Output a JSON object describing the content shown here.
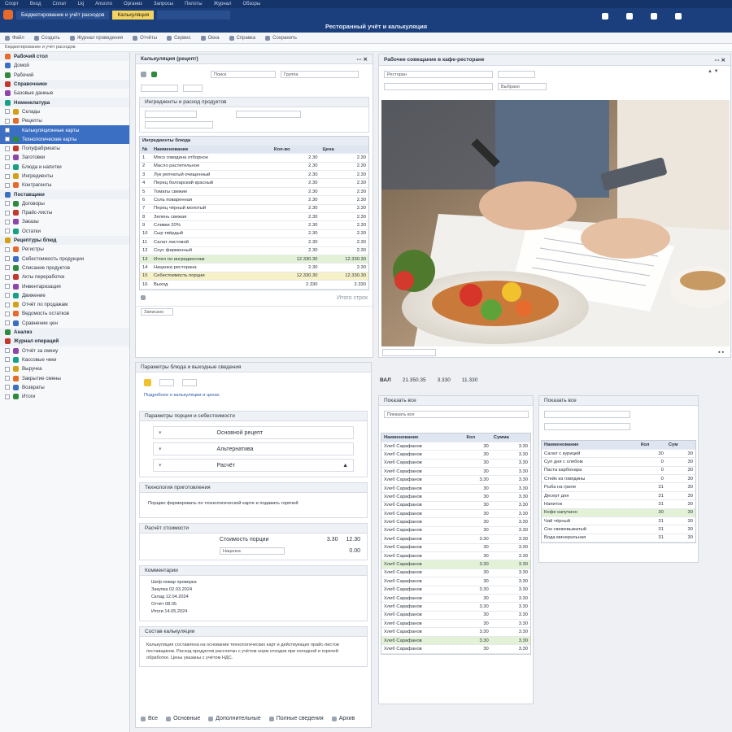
{
  "menu": [
    "Спорт",
    "Вход",
    "Сплат",
    "Lkj",
    "Аполло",
    "Организ",
    "Запросы",
    "Пилоты",
    "Журнал",
    "Обзоры"
  ],
  "app": {
    "title": "Бюджетирование и учёт расходов",
    "center_title": "Ресторанный учёт и калькуляция",
    "tab_active": "Калькуляция"
  },
  "toolbar": [
    "Файл",
    "Создать",
    "Журнал проведения",
    "Отчёты",
    "Сервис",
    "Окна",
    "Справка",
    "Сохранить"
  ],
  "sidebar": {
    "items": [
      {
        "label": "Рабочий стол",
        "type": "sec"
      },
      {
        "label": "Домой",
        "type": "item"
      },
      {
        "label": "Рабочий",
        "type": "item"
      },
      {
        "label": "Справочники",
        "type": "sec"
      },
      {
        "label": "Базовые данные",
        "type": "item"
      },
      {
        "label": "Номенклатура",
        "type": "sec"
      },
      {
        "label": "Склады",
        "type": "check"
      },
      {
        "label": "Рецепты",
        "type": "check"
      },
      {
        "label": "Калькуляционные карты",
        "type": "sel"
      },
      {
        "label": "Технологические карты",
        "type": "sel"
      },
      {
        "label": "Полуфабрикаты",
        "type": "check"
      },
      {
        "label": "Заготовки",
        "type": "check"
      },
      {
        "label": "Блюда и напитки",
        "type": "check"
      },
      {
        "label": "Ингредиенты",
        "type": "check"
      },
      {
        "label": "Контрагенты",
        "type": "check"
      },
      {
        "label": "Поставщики",
        "type": "sec"
      },
      {
        "label": "Договоры",
        "type": "check"
      },
      {
        "label": "Прайс-листы",
        "type": "check"
      },
      {
        "label": "Заказы",
        "type": "check"
      },
      {
        "label": "Остатки",
        "type": "check"
      },
      {
        "label": "Рецептуры блюд",
        "type": "sec"
      },
      {
        "label": "Регистры",
        "type": "check"
      },
      {
        "label": "Себестоимость продукции",
        "type": "check"
      },
      {
        "label": "Списание продуктов",
        "type": "check"
      },
      {
        "label": "Акты переработки",
        "type": "check"
      },
      {
        "label": "Инвентаризация",
        "type": "check"
      },
      {
        "label": "Движение",
        "type": "check"
      },
      {
        "label": "Отчёт по продажам",
        "type": "check"
      },
      {
        "label": "Ведомость остатков",
        "type": "check"
      },
      {
        "label": "Сравнение цен",
        "type": "check"
      },
      {
        "label": "Анализ",
        "type": "sec"
      },
      {
        "label": "Журнал операций",
        "type": "sec"
      },
      {
        "label": "Отчёт за смену",
        "type": "check"
      },
      {
        "label": "Кассовые чеки",
        "type": "check"
      },
      {
        "label": "Выручка",
        "type": "check"
      },
      {
        "label": "Закрытие смены",
        "type": "check"
      },
      {
        "label": "Возвраты",
        "type": "check"
      },
      {
        "label": "Итоги",
        "type": "check"
      }
    ]
  },
  "calc_panel": {
    "title": "Калькуляция (рецепт)",
    "sub": "Ингредиенты и расход продуктов",
    "search": "Поиск",
    "group": "Группа",
    "table_title": "Ингредиенты блюда",
    "columns": [
      "№",
      "Наименование",
      "Кол-во",
      "Цена"
    ],
    "rows": [
      {
        "n": "1",
        "name": "Мясо говядина отборное",
        "q": "2.30",
        "p": "2.30",
        "cls": ""
      },
      {
        "n": "2",
        "name": "Масло растительное",
        "q": "2.30",
        "p": "2.30",
        "cls": ""
      },
      {
        "n": "3",
        "name": "Лук репчатый очищенный",
        "q": "2.30",
        "p": "2.30",
        "cls": ""
      },
      {
        "n": "4",
        "name": "Перец болгарский красный",
        "q": "2.30",
        "p": "2.30",
        "cls": ""
      },
      {
        "n": "5",
        "name": "Томаты свежие",
        "q": "2.30",
        "p": "2.30",
        "cls": ""
      },
      {
        "n": "6",
        "name": "Соль поваренная",
        "q": "2.30",
        "p": "2.30",
        "cls": ""
      },
      {
        "n": "7",
        "name": "Перец чёрный молотый",
        "q": "2.30",
        "p": "2.30",
        "cls": ""
      },
      {
        "n": "8",
        "name": "Зелень свежая",
        "q": "2.30",
        "p": "2.30",
        "cls": ""
      },
      {
        "n": "9",
        "name": "Сливки 20%",
        "q": "2.30",
        "p": "2.30",
        "cls": ""
      },
      {
        "n": "10",
        "name": "Сыр твёрдый",
        "q": "2.30",
        "p": "2.30",
        "cls": ""
      },
      {
        "n": "11",
        "name": "Салат листовой",
        "q": "2.30",
        "p": "2.30",
        "cls": ""
      },
      {
        "n": "12",
        "name": "Соус фирменный",
        "q": "2.30",
        "p": "2.30",
        "cls": ""
      },
      {
        "n": "13",
        "name": "Итого по ингредиентам",
        "q": "12.330.30",
        "p": "12.330.30",
        "cls": "hl"
      },
      {
        "n": "14",
        "name": "Наценка ресторана",
        "q": "2.30",
        "p": "2.30",
        "cls": ""
      },
      {
        "n": "15",
        "name": "Себестоимость порции",
        "q": "12.330.30",
        "p": "12.330.30",
        "cls": "hy"
      },
      {
        "n": "16",
        "name": "Выход",
        "q": "2.330",
        "p": "2.330",
        "cls": ""
      }
    ],
    "footer": "Итого строк",
    "status": "Записано"
  },
  "photo_panel": {
    "title": "Рабочее совещание в кафе-ресторане",
    "field1": "Ресторан",
    "field2": "Выбрано"
  },
  "detail_panel": {
    "header": "Параметры блюда и выходные сведения",
    "link": "Подробнее о калькуляции и ценах",
    "sec1": "Параметры порции и себестоимости",
    "opt1": "Основной рецепт",
    "opt2": "Альтернатива",
    "opt3": "Расчёт",
    "sec2": "Технология приготовления",
    "text2": "Порцию формировать по технологической карте и подавать горячей",
    "sec3": "Расчёт стоимости",
    "calc_label": "Стоимость порции",
    "calc_a": "3.30",
    "calc_b": "12.30",
    "calc_label2": "Наценка",
    "calc_c": "0.00",
    "sec4": "Комментарии",
    "notes": [
      "Шеф-повар проверка",
      "Закупка 02.03.2024",
      "Склад 12.04.2024",
      "Отчёт 08.05",
      "Итоги 14.05.2024"
    ],
    "sec5": "Состав калькуляции",
    "para": "Калькуляция составлена на основании технологических карт и действующих прайс-листов поставщиков. Расход продуктов рассчитан с учётом норм отходов при холодной и горячей обработке. Цены указаны с учётом НДС.",
    "tabs": [
      "Все",
      "Основные",
      "Дополнительные",
      "Полные сведения",
      "Архив"
    ]
  },
  "stats": {
    "label": "ВАЛ",
    "v1": "21.350.35",
    "v2": "3.330",
    "v3": "11.330"
  },
  "right_table": {
    "filter": "Показать все",
    "columns": [
      "Наименование",
      "Кол",
      "Сумма"
    ],
    "rows": [
      {
        "name": "Хлеб Сарафанов",
        "q": "30",
        "p": "3.30",
        "cls": ""
      },
      {
        "name": "Хлеб Сарафанов",
        "q": "30",
        "p": "3.30",
        "cls": ""
      },
      {
        "name": "Хлеб Сарафанов",
        "q": "30",
        "p": "3.30",
        "cls": ""
      },
      {
        "name": "Хлеб Сарафанов",
        "q": "30",
        "p": "3.30",
        "cls": ""
      },
      {
        "name": "Хлеб Сарафанов",
        "q": "3.30",
        "p": "3.30",
        "cls": ""
      },
      {
        "name": "Хлеб Сарафанов",
        "q": "30",
        "p": "3.30",
        "cls": ""
      },
      {
        "name": "Хлеб Сарафанов",
        "q": "30",
        "p": "3.30",
        "cls": ""
      },
      {
        "name": "Хлеб Сарафанов",
        "q": "30",
        "p": "3.30",
        "cls": ""
      },
      {
        "name": "Хлеб Сарафанов",
        "q": "30",
        "p": "3.30",
        "cls": ""
      },
      {
        "name": "Хлеб Сарафанов",
        "q": "30",
        "p": "3.30",
        "cls": ""
      },
      {
        "name": "Хлеб Сарафанов",
        "q": "30",
        "p": "3.30",
        "cls": ""
      },
      {
        "name": "Хлеб Сарафанов",
        "q": "3.30",
        "p": "3.30",
        "cls": ""
      },
      {
        "name": "Хлеб Сарафанов",
        "q": "30",
        "p": "3.30",
        "cls": ""
      },
      {
        "name": "Хлеб Сарафанов",
        "q": "30",
        "p": "3.30",
        "cls": ""
      },
      {
        "name": "Хлеб Сарафанов",
        "q": "3.30",
        "p": "3.30",
        "cls": "hl"
      },
      {
        "name": "Хлеб Сарафанов",
        "q": "30",
        "p": "3.30",
        "cls": ""
      },
      {
        "name": "Хлеб Сарафанов",
        "q": "30",
        "p": "3.30",
        "cls": ""
      },
      {
        "name": "Хлеб Сарафанов",
        "q": "3.30",
        "p": "3.30",
        "cls": ""
      },
      {
        "name": "Хлеб Сарафанов",
        "q": "30",
        "p": "3.30",
        "cls": ""
      },
      {
        "name": "Хлеб Сарафанов",
        "q": "3.30",
        "p": "3.30",
        "cls": ""
      },
      {
        "name": "Хлеб Сарафанов",
        "q": "30",
        "p": "3.30",
        "cls": ""
      },
      {
        "name": "Хлеб Сарафанов",
        "q": "30",
        "p": "3.30",
        "cls": ""
      },
      {
        "name": "Хлеб Сарафанов",
        "q": "3.30",
        "p": "3.30",
        "cls": ""
      },
      {
        "name": "Хлеб Сарафанов",
        "q": "3.30",
        "p": "3.30",
        "cls": "hl"
      },
      {
        "name": "Хлеб Сарафанов",
        "q": "30",
        "p": "3.30",
        "cls": ""
      }
    ]
  },
  "small_table": {
    "columns": [
      "Наименование",
      "Кол",
      "Сум"
    ],
    "rows": [
      {
        "name": "Салат с курицей",
        "q": "30",
        "p": "30",
        "cls": ""
      },
      {
        "name": "Суп дня с хлебом",
        "q": "0",
        "p": "30",
        "cls": ""
      },
      {
        "name": "Паста карбонара",
        "q": "0",
        "p": "30",
        "cls": ""
      },
      {
        "name": "Стейк из говядины",
        "q": "0",
        "p": "30",
        "cls": ""
      },
      {
        "name": "Рыба на гриле",
        "q": "31",
        "p": "30",
        "cls": ""
      },
      {
        "name": "Десерт дня",
        "q": "31",
        "p": "30",
        "cls": ""
      },
      {
        "name": "Напиток",
        "q": "31",
        "p": "30",
        "cls": ""
      },
      {
        "name": "Кофе капучино",
        "q": "30",
        "p": "30",
        "cls": "hl"
      },
      {
        "name": "Чай чёрный",
        "q": "31",
        "p": "30",
        "cls": ""
      },
      {
        "name": "Сок свежевыжатый",
        "q": "31",
        "p": "30",
        "cls": ""
      },
      {
        "name": "Вода минеральная",
        "q": "31",
        "p": "30",
        "cls": ""
      }
    ]
  },
  "colors": {
    "accent": "#3b6fc4",
    "header": "#1b3f7c",
    "highlight": "#e3f2d6"
  }
}
